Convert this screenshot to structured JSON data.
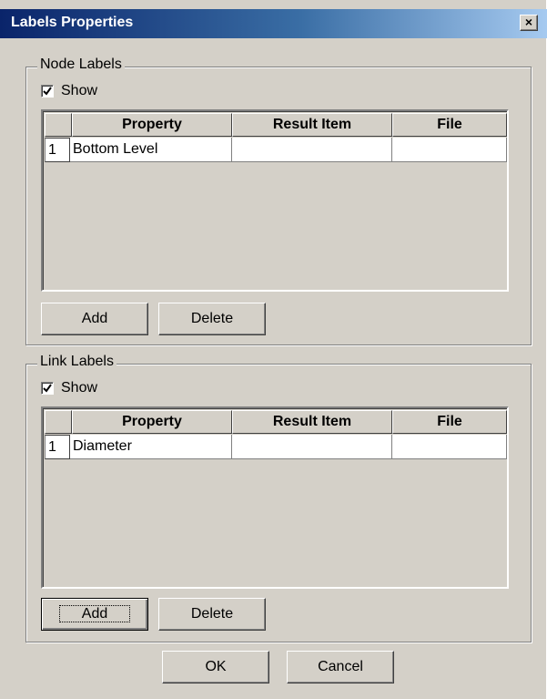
{
  "window": {
    "title": "Labels Properties",
    "close_glyph": "×"
  },
  "node_labels": {
    "legend": "Node Labels",
    "show_label": "Show",
    "show_checked": true,
    "columns": [
      "Property",
      "Result Item",
      "File"
    ],
    "rows": [
      {
        "num": "1",
        "property": "Bottom Level",
        "result_item": "",
        "file": ""
      }
    ],
    "add_label": "Add",
    "delete_label": "Delete"
  },
  "link_labels": {
    "legend": "Link Labels",
    "show_label": "Show",
    "show_checked": true,
    "columns": [
      "Property",
      "Result Item",
      "File"
    ],
    "rows": [
      {
        "num": "1",
        "property": "Diameter",
        "result_item": "",
        "file": ""
      }
    ],
    "add_label": "Add",
    "delete_label": "Delete"
  },
  "footer": {
    "ok_label": "OK",
    "cancel_label": "Cancel"
  }
}
